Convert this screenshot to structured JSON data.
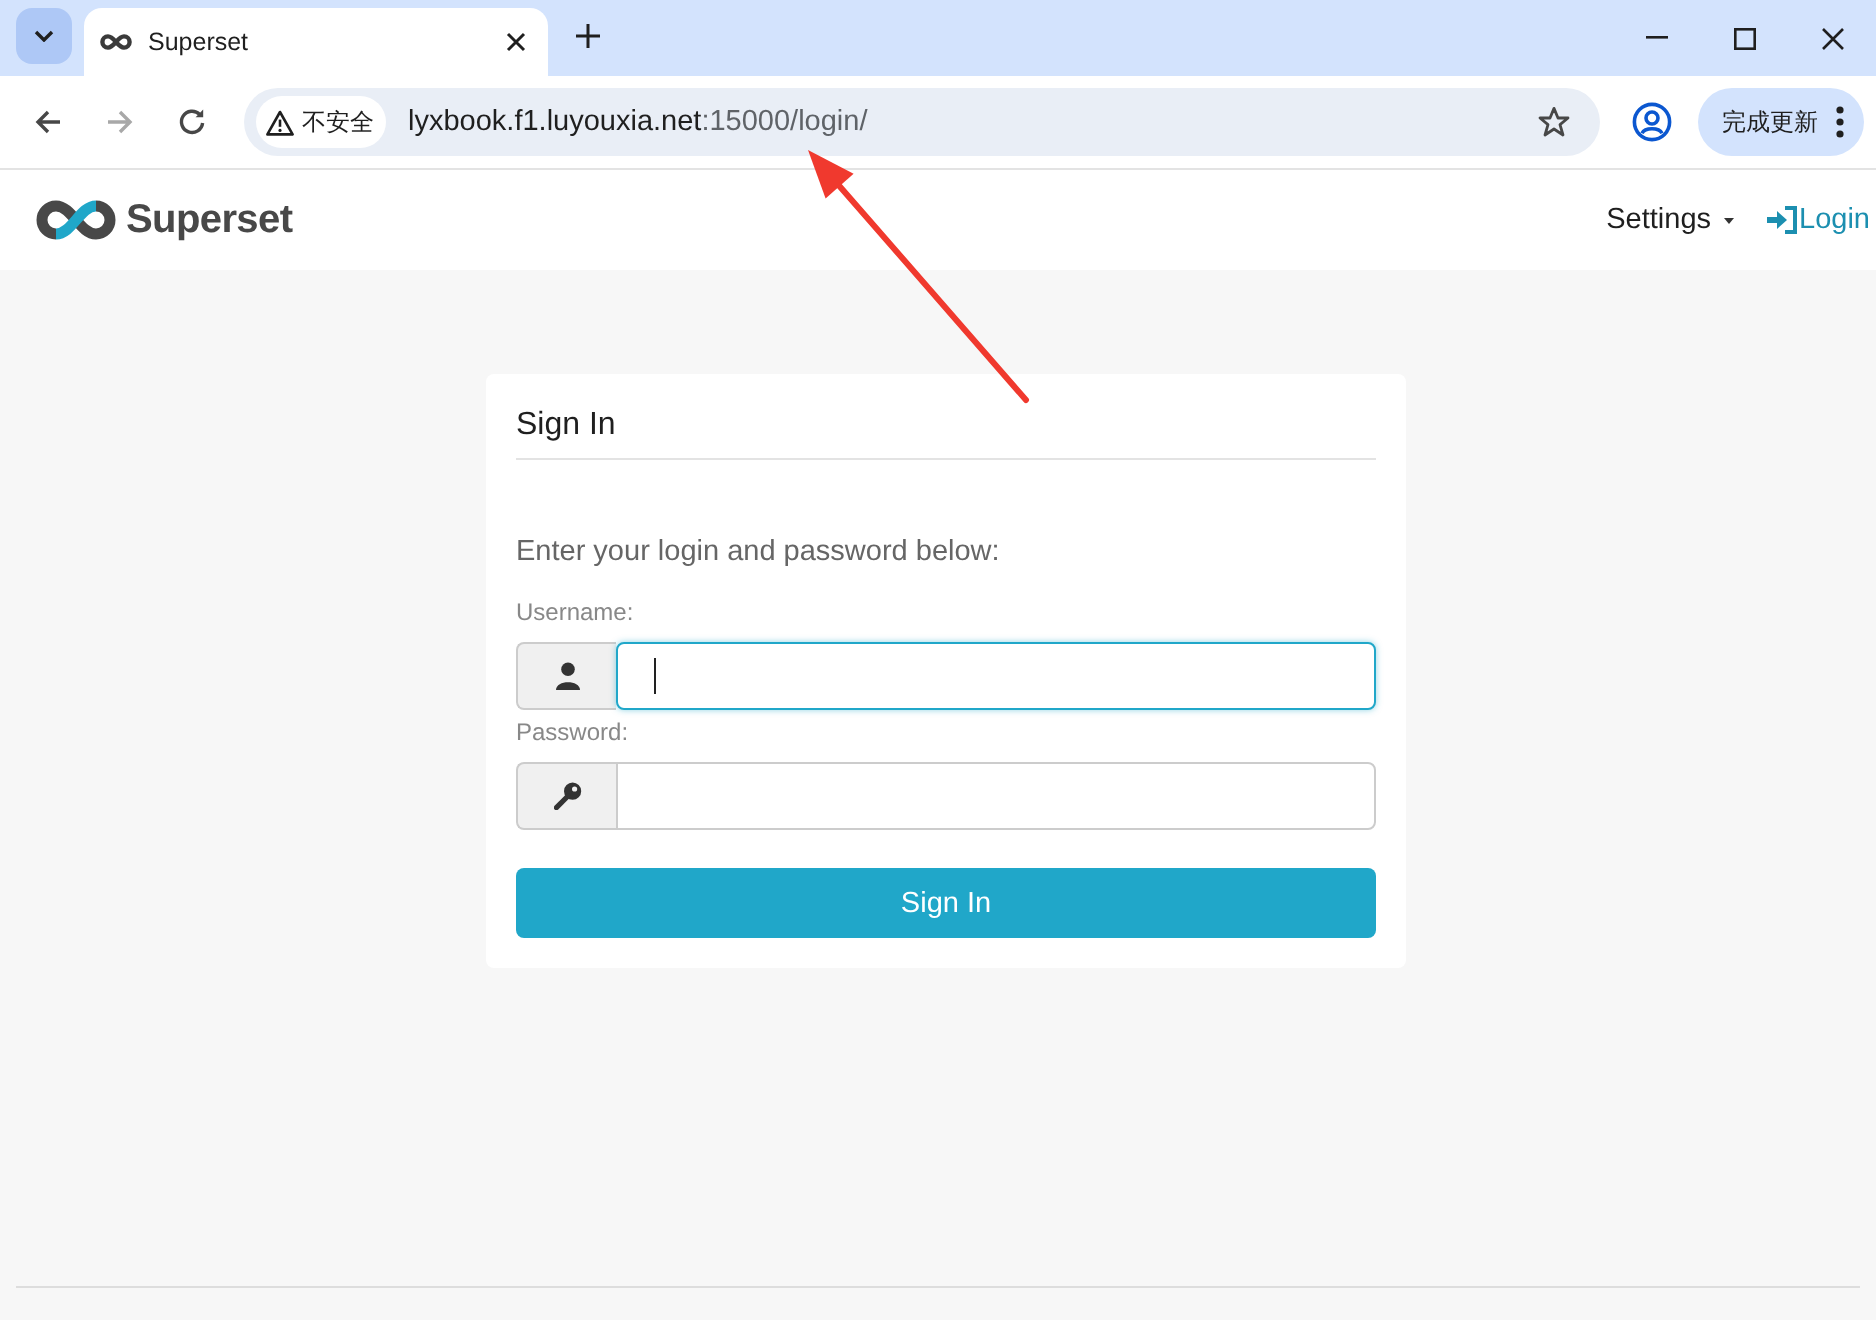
{
  "browser": {
    "tabs": [
      {
        "title": "Superset",
        "selected": true
      }
    ],
    "address_bar": {
      "security_chip": "不安全",
      "url": {
        "host": "lyxbook.f1.luyouxia.net",
        "rest": ":15000/login/"
      }
    },
    "update_button": "完成更新"
  },
  "navbar": {
    "brand": "Superset",
    "menu": [
      {
        "label": "Settings",
        "kind": "dropdown"
      },
      {
        "label": "Login",
        "kind": "login"
      }
    ]
  },
  "login_panel": {
    "title": "Sign In",
    "instructions": "Enter your login and password below:",
    "fields": [
      {
        "label": "Username:",
        "kind": "username",
        "focused": true
      },
      {
        "label": "Password:",
        "kind": "password",
        "focused": false
      }
    ],
    "submit_button": "Sign In"
  }
}
